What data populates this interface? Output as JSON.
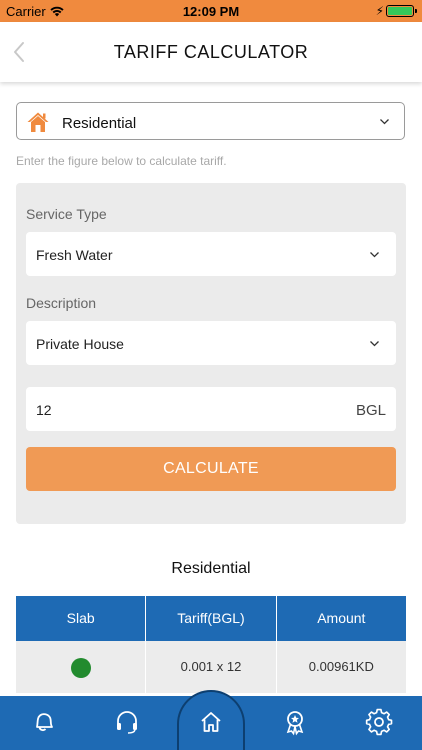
{
  "status_bar": {
    "carrier": "Carrier",
    "time": "12:09 PM"
  },
  "nav": {
    "title": "TARIFF CALCULATOR",
    "back_icon": "chevron-left-icon"
  },
  "category": {
    "selected": "Residential",
    "icon": "home-icon"
  },
  "hint": "Enter the figure below to calculate tariff.",
  "form": {
    "service_type_label": "Service Type",
    "service_type_value": "Fresh Water",
    "description_label": "Description",
    "description_value": "Private House",
    "quantity_value": "12",
    "quantity_unit": "BGL",
    "calculate_label": "CALCULATE"
  },
  "result": {
    "title": "Residential",
    "columns": [
      "Slab",
      "Tariff(BGL)",
      "Amount"
    ],
    "rows": [
      {
        "slab_color": "#228b2e",
        "tariff": "0.001 x 12",
        "amount": "0.00961KD"
      }
    ]
  },
  "tabs": [
    "bell-icon",
    "headset-icon",
    "home-icon",
    "award-icon",
    "gear-icon"
  ],
  "colors": {
    "accent_orange": "#f08a3e",
    "button_orange": "#f09a55",
    "primary_blue": "#1e6ab4"
  }
}
